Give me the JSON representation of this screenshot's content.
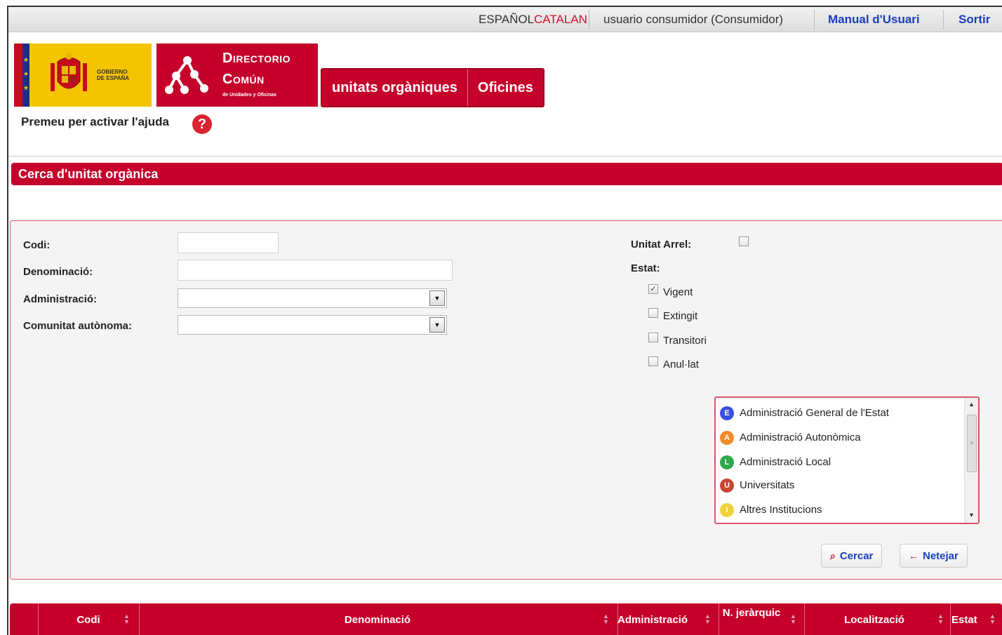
{
  "topbar": {
    "lang_es": "ESPAÑOL",
    "lang_ca": "CATALAN",
    "user": "usuario consumidor (Consumidor)",
    "manual": "Manual d'Usuari",
    "logout": "Sortir"
  },
  "header": {
    "gov_logo_text_1": "GOBIERNO",
    "gov_logo_text_2": "DE ESPAÑA",
    "dir_logo_line1": "Directorio",
    "dir_logo_line2": "Común",
    "dir_logo_line3": "de Unidades y Oficinas",
    "tabs": [
      "unitats orgàniques",
      "Oficines"
    ],
    "help_text": "Premeu per activar l'ajuda"
  },
  "section_title": "Cerca d'unitat orgànica",
  "form": {
    "codi_label": "Codi:",
    "codi_value": "",
    "denominacio_label": "Denominació:",
    "denominacio_value": "",
    "administracio_label": "Administració:",
    "administracio_value": "",
    "comunitat_label": "Comunitat autònoma:",
    "comunitat_value": "",
    "unitat_arrel_label": "Unitat Arrel:",
    "unitat_arrel_checked": false,
    "estat_label": "Estat:",
    "estat_options": [
      {
        "label": "Vigent",
        "checked": true
      },
      {
        "label": "Extingit",
        "checked": false
      },
      {
        "label": "Transitori",
        "checked": false
      },
      {
        "label": "Anul·lat",
        "checked": false
      }
    ]
  },
  "admin_types": [
    {
      "letter": "E",
      "label": "Administració General de l'Estat",
      "color": "#3a4fe0"
    },
    {
      "letter": "A",
      "label": "Administració Autonòmica",
      "color": "#f08a2a"
    },
    {
      "letter": "L",
      "label": "Administració Local",
      "color": "#2ea84a"
    },
    {
      "letter": "U",
      "label": "Universitats",
      "color": "#c8452f"
    },
    {
      "letter": "I",
      "label": "Altres Institucions",
      "color": "#f2d23a"
    }
  ],
  "buttons": {
    "search": "Cercar",
    "clear": "Netejar"
  },
  "table": {
    "headers": [
      "Codi",
      "Denominació",
      "Administració",
      "N. jeràrquic",
      "Localització",
      "Estat"
    ]
  }
}
